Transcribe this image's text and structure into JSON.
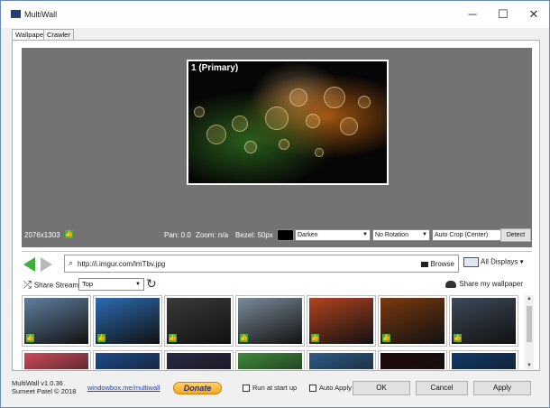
{
  "window": {
    "title": "MultiWall",
    "minimize_glyph": "─",
    "maximize_glyph": "☐",
    "close_glyph": "✕"
  },
  "tabs": [
    {
      "label": "Wallpaper",
      "active": true
    },
    {
      "label": "Crawler",
      "active": false
    }
  ],
  "preview": {
    "monitor_label": "1 (Primary)",
    "resolution": "2076x1303",
    "pan": "Pan: 0.0",
    "zoom": "Zoom: n/a",
    "bezel": "Bezel: 50px",
    "blend_mode": "Darken",
    "rotation": "No Rotation",
    "crop": "Auto Crop (Center)",
    "detect_label": "Detect"
  },
  "browser": {
    "url": "http://i.imgur.com/lmTbv.jpg",
    "browse_label": "Browse",
    "displays_label": "All Displays",
    "displays_arrow": "▾"
  },
  "stream": {
    "share_label": "Share Stream",
    "sort_value": "Top",
    "share_my_label": "Share my wallpaper"
  },
  "gallery": {
    "thumbnails": [
      {
        "icon": "earth-horizon",
        "color": "#5f7f9f"
      },
      {
        "icon": "city-skyline",
        "color": "#2c6bb3"
      },
      {
        "icon": "portal-figure",
        "color": "#3a3a3a"
      },
      {
        "icon": "astronaut",
        "color": "#7a8a9a"
      },
      {
        "icon": "rainbow-lines",
        "color": "#b3441f"
      },
      {
        "icon": "bokeh-lights",
        "color": "#7a3a10"
      },
      {
        "icon": "eagle",
        "color": "#3e4a5a"
      },
      {
        "icon": "paint-splash",
        "color": "#cc4a5a"
      },
      {
        "icon": "earth-globe",
        "color": "#1f4a8a"
      },
      {
        "icon": "earth-sunrise",
        "color": "#2a2a44"
      },
      {
        "icon": "green-hills",
        "color": "#3f8a3a"
      },
      {
        "icon": "shuttle",
        "color": "#2f5c8a"
      },
      {
        "icon": "red-streak",
        "color": "#1e0a0a"
      },
      {
        "icon": "blue-planet",
        "color": "#133a6a"
      }
    ],
    "like_glyph": "👍"
  },
  "footer": {
    "version": "MultiWall v1.0.36",
    "author": "Sumeet Patel © 2018",
    "link": "windowbox.me/multiwall",
    "donate_label": "Donate",
    "run_at_startup": "Run at start up",
    "auto_apply": "Auto Apply",
    "ok_label": "OK",
    "cancel_label": "Cancel",
    "apply_label": "Apply"
  }
}
